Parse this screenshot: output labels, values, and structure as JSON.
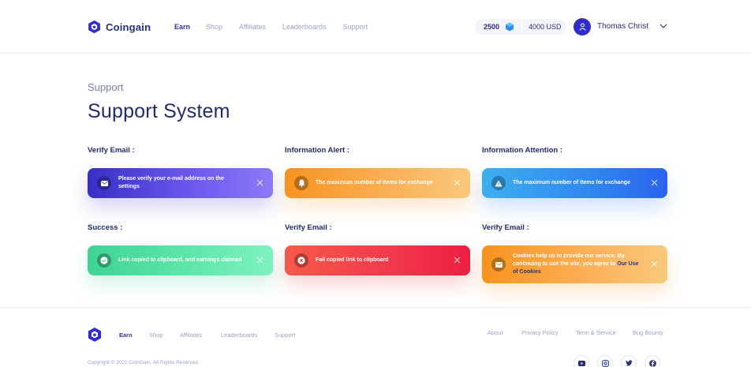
{
  "header": {
    "brand": "Coingain",
    "nav": [
      {
        "label": "Earn",
        "active": true
      },
      {
        "label": "Shop",
        "active": false
      },
      {
        "label": "Affiliates",
        "active": false
      },
      {
        "label": "Leaderboards",
        "active": false
      },
      {
        "label": "Support",
        "active": false
      }
    ],
    "balance_coins": "2500",
    "balance_usd": "4000 USD",
    "user_name": "Thomas Christ"
  },
  "page": {
    "breadcrumb": "Support",
    "title": "Support System"
  },
  "alerts": [
    {
      "label": "Verify Email :",
      "message": "Please verify your e-mail address on the settings",
      "icon": "mail-icon"
    },
    {
      "label": "Information Alert :",
      "message": "The maximum number of items for exchange",
      "icon": "bell-icon"
    },
    {
      "label": "Information Attention :",
      "message": "The maximum number of items for exchange",
      "icon": "warning-icon"
    },
    {
      "label": "Success :",
      "message": "Link copied to clipboard, and earnings claimed",
      "icon": "check-icon"
    },
    {
      "label": "Verify Email :",
      "message": "Fail copied link to clipboard",
      "icon": "error-x-icon"
    },
    {
      "label": "Verify Email :",
      "message": "Cookies help us to provide our service. By continuing to use the site, you agree to",
      "link": "Our Use of Cookies",
      "icon": "mail-icon"
    }
  ],
  "footer": {
    "nav": [
      "Earn",
      "Shop",
      "Affiliates",
      "Leaderboards",
      "Support"
    ],
    "links": [
      "About",
      "Privacy Policy",
      "Term & Service",
      "Bug Bounty"
    ],
    "copyright": "Copyright © 2021 CoinGain. All Rights Reserved.",
    "social": [
      "youtube-icon",
      "instagram-icon",
      "twitter-icon",
      "facebook-icon"
    ]
  },
  "colors": {
    "brand": "#2a2f7a",
    "primary": "#3033a8",
    "muted": "#9aa1c4"
  }
}
